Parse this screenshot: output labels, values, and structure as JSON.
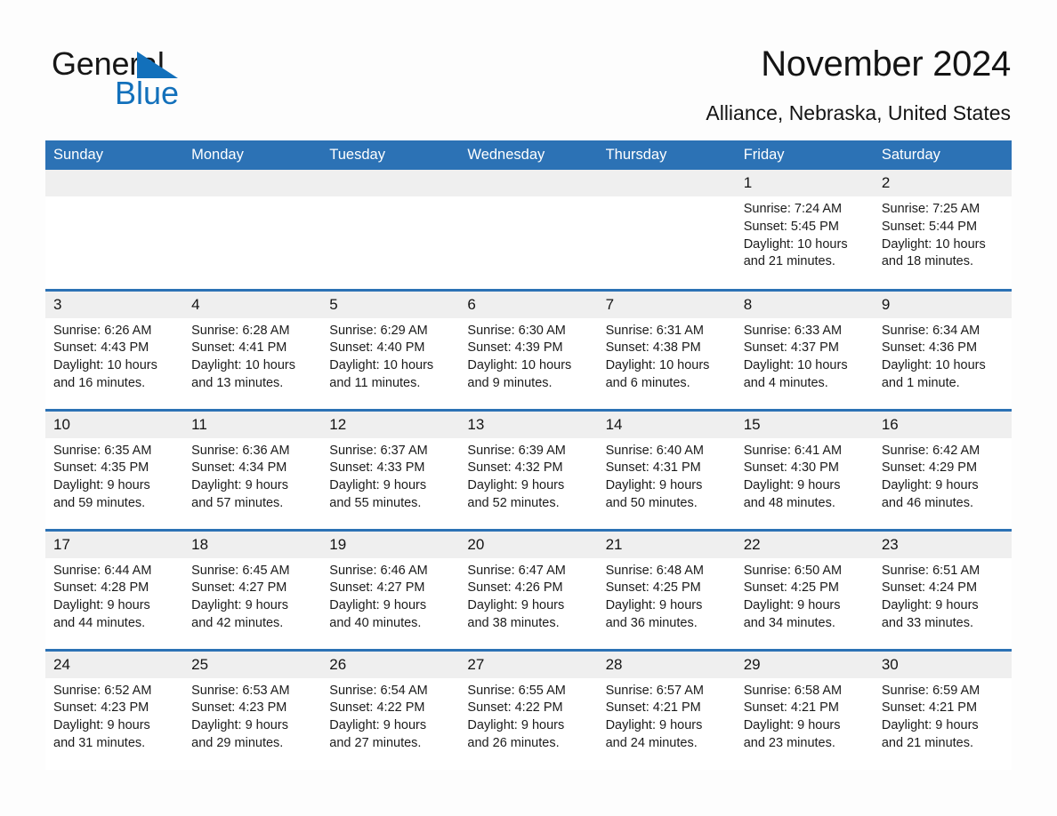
{
  "brand": {
    "name_part1": "General",
    "name_part2": "Blue",
    "triangle_color": "#1270bb",
    "text_color": "#161616"
  },
  "header": {
    "title": "November 2024",
    "subtitle": "Alliance, Nebraska, United States",
    "accent_color": "#2c72b5"
  },
  "calendar": {
    "weekday_headers": [
      "Sunday",
      "Monday",
      "Tuesday",
      "Wednesday",
      "Thursday",
      "Friday",
      "Saturday"
    ],
    "weeks": [
      [
        {
          "day": "",
          "empty": true,
          "sunrise": "",
          "sunset": "",
          "daylight1": "",
          "daylight2": ""
        },
        {
          "day": "",
          "empty": true,
          "sunrise": "",
          "sunset": "",
          "daylight1": "",
          "daylight2": ""
        },
        {
          "day": "",
          "empty": true,
          "sunrise": "",
          "sunset": "",
          "daylight1": "",
          "daylight2": ""
        },
        {
          "day": "",
          "empty": true,
          "sunrise": "",
          "sunset": "",
          "daylight1": "",
          "daylight2": ""
        },
        {
          "day": "",
          "empty": true,
          "sunrise": "",
          "sunset": "",
          "daylight1": "",
          "daylight2": ""
        },
        {
          "day": "1",
          "sunrise": "Sunrise: 7:24 AM",
          "sunset": "Sunset: 5:45 PM",
          "daylight1": "Daylight: 10 hours",
          "daylight2": "and 21 minutes."
        },
        {
          "day": "2",
          "sunrise": "Sunrise: 7:25 AM",
          "sunset": "Sunset: 5:44 PM",
          "daylight1": "Daylight: 10 hours",
          "daylight2": "and 18 minutes."
        }
      ],
      [
        {
          "day": "3",
          "sunrise": "Sunrise: 6:26 AM",
          "sunset": "Sunset: 4:43 PM",
          "daylight1": "Daylight: 10 hours",
          "daylight2": "and 16 minutes."
        },
        {
          "day": "4",
          "sunrise": "Sunrise: 6:28 AM",
          "sunset": "Sunset: 4:41 PM",
          "daylight1": "Daylight: 10 hours",
          "daylight2": "and 13 minutes."
        },
        {
          "day": "5",
          "sunrise": "Sunrise: 6:29 AM",
          "sunset": "Sunset: 4:40 PM",
          "daylight1": "Daylight: 10 hours",
          "daylight2": "and 11 minutes."
        },
        {
          "day": "6",
          "sunrise": "Sunrise: 6:30 AM",
          "sunset": "Sunset: 4:39 PM",
          "daylight1": "Daylight: 10 hours",
          "daylight2": "and 9 minutes."
        },
        {
          "day": "7",
          "sunrise": "Sunrise: 6:31 AM",
          "sunset": "Sunset: 4:38 PM",
          "daylight1": "Daylight: 10 hours",
          "daylight2": "and 6 minutes."
        },
        {
          "day": "8",
          "sunrise": "Sunrise: 6:33 AM",
          "sunset": "Sunset: 4:37 PM",
          "daylight1": "Daylight: 10 hours",
          "daylight2": "and 4 minutes."
        },
        {
          "day": "9",
          "sunrise": "Sunrise: 6:34 AM",
          "sunset": "Sunset: 4:36 PM",
          "daylight1": "Daylight: 10 hours",
          "daylight2": "and 1 minute."
        }
      ],
      [
        {
          "day": "10",
          "sunrise": "Sunrise: 6:35 AM",
          "sunset": "Sunset: 4:35 PM",
          "daylight1": "Daylight: 9 hours",
          "daylight2": "and 59 minutes."
        },
        {
          "day": "11",
          "sunrise": "Sunrise: 6:36 AM",
          "sunset": "Sunset: 4:34 PM",
          "daylight1": "Daylight: 9 hours",
          "daylight2": "and 57 minutes."
        },
        {
          "day": "12",
          "sunrise": "Sunrise: 6:37 AM",
          "sunset": "Sunset: 4:33 PM",
          "daylight1": "Daylight: 9 hours",
          "daylight2": "and 55 minutes."
        },
        {
          "day": "13",
          "sunrise": "Sunrise: 6:39 AM",
          "sunset": "Sunset: 4:32 PM",
          "daylight1": "Daylight: 9 hours",
          "daylight2": "and 52 minutes."
        },
        {
          "day": "14",
          "sunrise": "Sunrise: 6:40 AM",
          "sunset": "Sunset: 4:31 PM",
          "daylight1": "Daylight: 9 hours",
          "daylight2": "and 50 minutes."
        },
        {
          "day": "15",
          "sunrise": "Sunrise: 6:41 AM",
          "sunset": "Sunset: 4:30 PM",
          "daylight1": "Daylight: 9 hours",
          "daylight2": "and 48 minutes."
        },
        {
          "day": "16",
          "sunrise": "Sunrise: 6:42 AM",
          "sunset": "Sunset: 4:29 PM",
          "daylight1": "Daylight: 9 hours",
          "daylight2": "and 46 minutes."
        }
      ],
      [
        {
          "day": "17",
          "sunrise": "Sunrise: 6:44 AM",
          "sunset": "Sunset: 4:28 PM",
          "daylight1": "Daylight: 9 hours",
          "daylight2": "and 44 minutes."
        },
        {
          "day": "18",
          "sunrise": "Sunrise: 6:45 AM",
          "sunset": "Sunset: 4:27 PM",
          "daylight1": "Daylight: 9 hours",
          "daylight2": "and 42 minutes."
        },
        {
          "day": "19",
          "sunrise": "Sunrise: 6:46 AM",
          "sunset": "Sunset: 4:27 PM",
          "daylight1": "Daylight: 9 hours",
          "daylight2": "and 40 minutes."
        },
        {
          "day": "20",
          "sunrise": "Sunrise: 6:47 AM",
          "sunset": "Sunset: 4:26 PM",
          "daylight1": "Daylight: 9 hours",
          "daylight2": "and 38 minutes."
        },
        {
          "day": "21",
          "sunrise": "Sunrise: 6:48 AM",
          "sunset": "Sunset: 4:25 PM",
          "daylight1": "Daylight: 9 hours",
          "daylight2": "and 36 minutes."
        },
        {
          "day": "22",
          "sunrise": "Sunrise: 6:50 AM",
          "sunset": "Sunset: 4:25 PM",
          "daylight1": "Daylight: 9 hours",
          "daylight2": "and 34 minutes."
        },
        {
          "day": "23",
          "sunrise": "Sunrise: 6:51 AM",
          "sunset": "Sunset: 4:24 PM",
          "daylight1": "Daylight: 9 hours",
          "daylight2": "and 33 minutes."
        }
      ],
      [
        {
          "day": "24",
          "sunrise": "Sunrise: 6:52 AM",
          "sunset": "Sunset: 4:23 PM",
          "daylight1": "Daylight: 9 hours",
          "daylight2": "and 31 minutes."
        },
        {
          "day": "25",
          "sunrise": "Sunrise: 6:53 AM",
          "sunset": "Sunset: 4:23 PM",
          "daylight1": "Daylight: 9 hours",
          "daylight2": "and 29 minutes."
        },
        {
          "day": "26",
          "sunrise": "Sunrise: 6:54 AM",
          "sunset": "Sunset: 4:22 PM",
          "daylight1": "Daylight: 9 hours",
          "daylight2": "and 27 minutes."
        },
        {
          "day": "27",
          "sunrise": "Sunrise: 6:55 AM",
          "sunset": "Sunset: 4:22 PM",
          "daylight1": "Daylight: 9 hours",
          "daylight2": "and 26 minutes."
        },
        {
          "day": "28",
          "sunrise": "Sunrise: 6:57 AM",
          "sunset": "Sunset: 4:21 PM",
          "daylight1": "Daylight: 9 hours",
          "daylight2": "and 24 minutes."
        },
        {
          "day": "29",
          "sunrise": "Sunrise: 6:58 AM",
          "sunset": "Sunset: 4:21 PM",
          "daylight1": "Daylight: 9 hours",
          "daylight2": "and 23 minutes."
        },
        {
          "day": "30",
          "sunrise": "Sunrise: 6:59 AM",
          "sunset": "Sunset: 4:21 PM",
          "daylight1": "Daylight: 9 hours",
          "daylight2": "and 21 minutes."
        }
      ]
    ]
  }
}
